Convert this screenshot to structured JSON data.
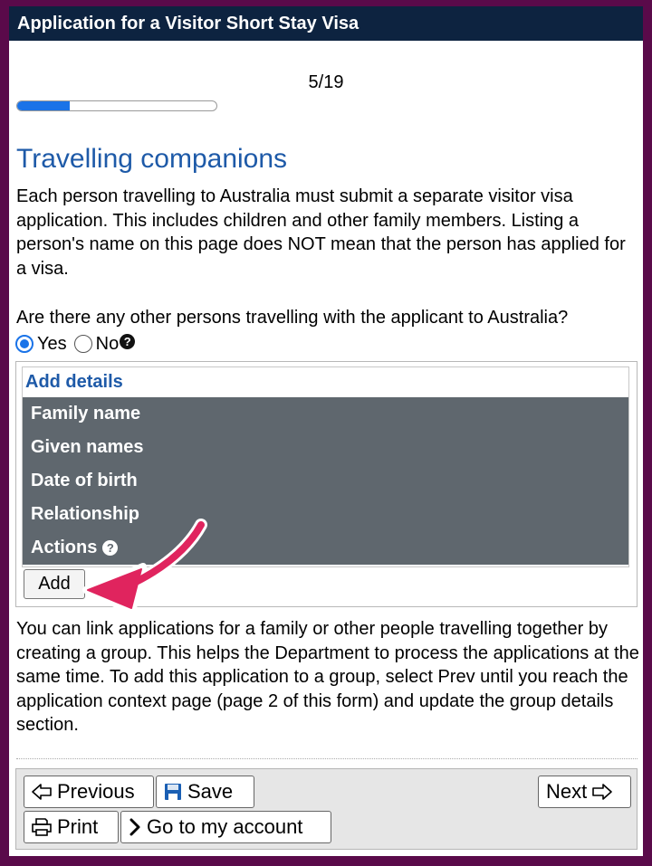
{
  "window": {
    "title": "Application for a Visitor Short Stay Visa"
  },
  "progress": {
    "page_label": "5/19",
    "fraction": 0.263
  },
  "section": {
    "heading": "Travelling companions",
    "intro": "Each person travelling to Australia must submit a separate visitor visa application. This includes children and other family members. Listing a person's name on this page does NOT mean that the person has applied for a visa."
  },
  "question": {
    "text": "Are there any other persons travelling with the applicant to Australia?",
    "options": [
      {
        "label": "Yes",
        "selected": true
      },
      {
        "label": "No",
        "selected": false
      }
    ],
    "help_icon": "question-circle-icon"
  },
  "details": {
    "title": "Add details",
    "columns": [
      "Family name",
      "Given names",
      "Date of birth",
      "Relationship",
      "Actions"
    ],
    "add_label": "Add"
  },
  "group_info": "You can link applications for a family or other people travelling together by creating a group. This helps the Department to process the applications at the same time. To add this application to a group, select Prev until you reach the application context page (page 2 of this form) and update the group details section.",
  "nav": {
    "previous_label": "Previous",
    "save_label": "Save",
    "next_label": "Next",
    "print_label": "Print",
    "account_label": "Go to my account"
  },
  "annotation": {
    "arrow_color": "#e0245e",
    "icon": "pointing-arrow-icon"
  },
  "colors": {
    "title_bar": "#0d2340",
    "heading": "#1e5aa8",
    "header_row": "#5f676e",
    "progress_fill": "#1a73e8",
    "outer_border": "#5a0a4a"
  }
}
